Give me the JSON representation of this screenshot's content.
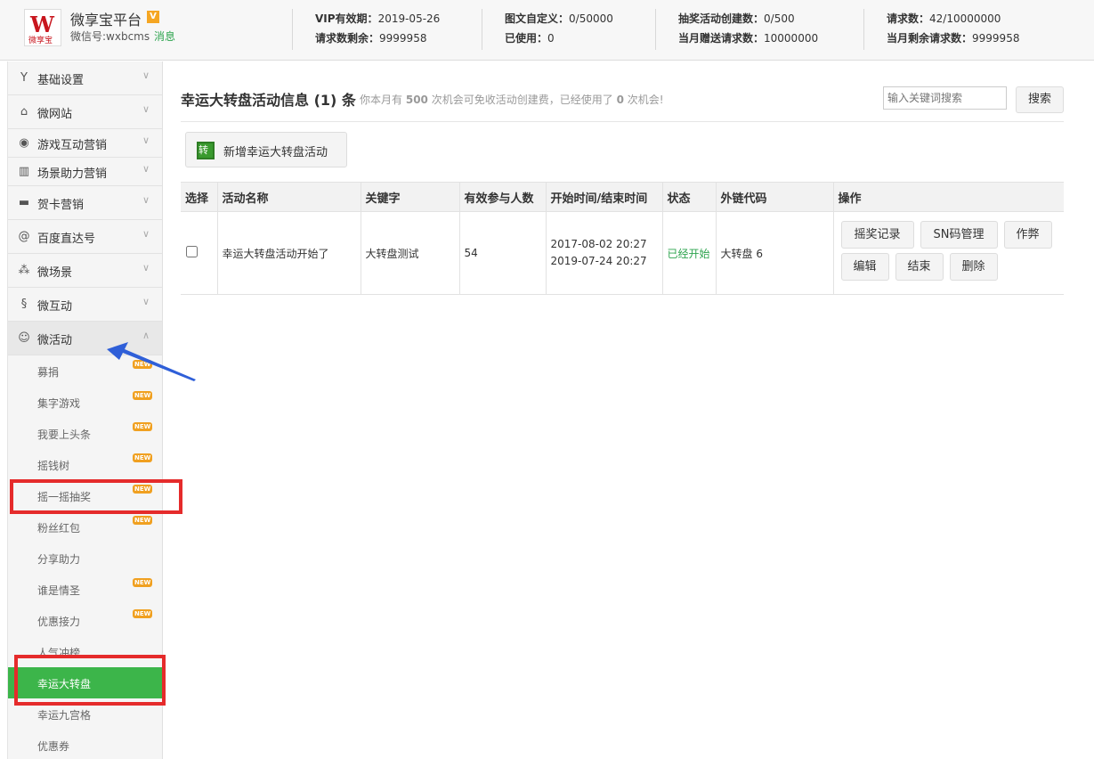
{
  "header": {
    "logo_glyph": "W",
    "logo_text": "微享宝",
    "title": "微享宝平台",
    "badge": "V",
    "wechat_id": "微信号:wxbcms",
    "message": "消息",
    "stats": [
      {
        "l1_label": "VIP有效期：",
        "l1_value": "2019-05-26",
        "l2_label": "请求数剩余：",
        "l2_value": "9999958"
      },
      {
        "l1_label": "图文自定义：",
        "l1_value": "0/50000",
        "l2_label": "已使用：",
        "l2_value": "0"
      },
      {
        "l1_label": "抽奖活动创建数：",
        "l1_value": "0/500",
        "l2_label": "当月赠送请求数：",
        "l2_value": "10000000"
      },
      {
        "l1_label": "请求数：",
        "l1_value": "42/10000000",
        "l2_label": "当月剩余请求数：",
        "l2_value": "9999958"
      }
    ]
  },
  "sidebar": {
    "menus": [
      {
        "label": "基础设置",
        "icon": "tools-icon",
        "glyph": "Y"
      },
      {
        "label": "微网站",
        "icon": "home-icon",
        "glyph": "⌂"
      },
      {
        "label": "游戏互动营销",
        "icon": "gamepad-icon",
        "glyph": "◉"
      },
      {
        "label": "场景助力营销",
        "icon": "bank-icon",
        "glyph": "▥"
      },
      {
        "label": "贺卡营销",
        "icon": "card-icon",
        "glyph": "▬"
      },
      {
        "label": "百度直达号",
        "icon": "at-icon",
        "glyph": "@"
      },
      {
        "label": "微场景",
        "icon": "cluster-icon",
        "glyph": "⁂"
      },
      {
        "label": "微互动",
        "icon": "link-icon",
        "glyph": "§"
      },
      {
        "label": "微活动",
        "icon": "smile-icon",
        "glyph": "☺"
      }
    ],
    "sub_items": [
      {
        "label": "募捐",
        "new": "NEW"
      },
      {
        "label": "集字游戏",
        "new": "NEW"
      },
      {
        "label": "我要上头条",
        "new": "NEW"
      },
      {
        "label": "摇钱树",
        "new": "NEW"
      },
      {
        "label": "摇一摇抽奖",
        "new": "NEW"
      },
      {
        "label": "粉丝红包",
        "new": "NEW"
      },
      {
        "label": "分享助力",
        "new": ""
      },
      {
        "label": "谁是情圣",
        "new": "NEW"
      },
      {
        "label": "优惠接力",
        "new": "NEW"
      },
      {
        "label": "人气冲榜",
        "new": ""
      },
      {
        "label": "幸运大转盘",
        "new": ""
      },
      {
        "label": "幸运九宫格",
        "new": ""
      },
      {
        "label": "优惠券",
        "new": ""
      }
    ]
  },
  "main": {
    "title": "幸运大转盘活动信息 (1) 条",
    "note_prefix": "你本月有",
    "note_count": "500",
    "note_mid": "次机会可免收活动创建费，已经使用了",
    "note_used": "0",
    "note_suffix": "次机会!",
    "search_placeholder": "输入关键词搜索",
    "search_button": "搜索",
    "add_icon_char": "转",
    "add_button": "新增幸运大转盘活动",
    "table": {
      "headers": [
        "选择",
        "活动名称",
        "关键字",
        "有效参与人数",
        "开始时间/结束时间",
        "状态",
        "外链代码",
        "操作"
      ],
      "rows": [
        {
          "name": "幸运大转盘活动开始了",
          "keyword": "大转盘测试",
          "participants": "54",
          "start_time": "2017-08-02 20:27",
          "end_time": "2019-07-24 20:27",
          "status": "已经开始",
          "link_code": "大转盘 6",
          "actions": [
            "摇奖记录",
            "SN码管理",
            "作弊",
            "编辑",
            "结束",
            "删除"
          ]
        }
      ]
    }
  },
  "colors": {
    "active_green": "#3cb54a",
    "annotation_red": "#e52b2b",
    "annotation_arrow_blue": "#2f5fd8",
    "status_green": "#2ea44f"
  }
}
